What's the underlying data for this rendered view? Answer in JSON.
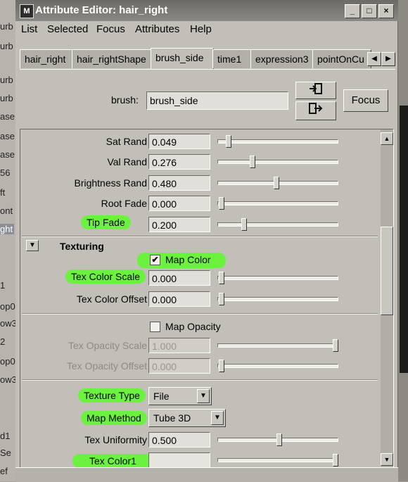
{
  "background_strip": [
    "urb",
    "urb",
    "urb",
    "urb",
    "ase",
    "ase",
    "ase",
    "56",
    "ft",
    "ont",
    "ght",
    "1",
    "op0",
    "ow3",
    "2",
    "op0",
    "ow3",
    "d1",
    "Se",
    "ef"
  ],
  "window": {
    "title": "Attribute Editor: hair_right",
    "app_icon": "M",
    "controls": {
      "minimize": "_",
      "maximize": "□",
      "close": "×"
    }
  },
  "menu": [
    "List",
    "Selected",
    "Focus",
    "Attributes",
    "Help"
  ],
  "tabs": [
    "hair_right",
    "hair_rightShape",
    "brush_side",
    "time1",
    "expression3",
    "pointOnCu"
  ],
  "active_tab": "brush_side",
  "brush": {
    "label": "brush:",
    "value": "brush_side"
  },
  "buttons": {
    "focus": "Focus",
    "load_icon": "load-node-icon",
    "select_icon": "select-node-icon"
  },
  "attrs": {
    "sat_rand": {
      "label": "Sat Rand",
      "value": "0.049",
      "slider": 0.05
    },
    "val_rand": {
      "label": "Val Rand",
      "value": "0.276",
      "slider": 0.28
    },
    "brightness_rand": {
      "label": "Brightness Rand",
      "value": "0.480",
      "slider": 0.48
    },
    "root_fade": {
      "label": "Root Fade",
      "value": "0.000",
      "slider": 0.0
    },
    "tip_fade": {
      "label": "Tip Fade",
      "value": "0.200",
      "slider": 0.2
    },
    "texturing_header": "Texturing",
    "map_color": {
      "label": "Map Color",
      "checked": "✔"
    },
    "tex_color_scale": {
      "label": "Tex Color Scale",
      "value": "0.000",
      "slider": 0.0
    },
    "tex_color_offset": {
      "label": "Tex Color Offset",
      "value": "0.000",
      "slider": 0.0
    },
    "map_opacity": {
      "label": "Map Opacity",
      "checked": ""
    },
    "tex_opacity_scale": {
      "label": "Tex Opacity Scale",
      "value": "1.000",
      "slider": 1.0
    },
    "tex_opacity_offset": {
      "label": "Tex Opacity Offset",
      "value": "0.000",
      "slider": 0.0
    },
    "texture_type": {
      "label": "Texture Type",
      "value": "File"
    },
    "map_method": {
      "label": "Map Method",
      "value": "Tube 3D"
    },
    "tex_uniformity": {
      "label": "Tex Uniformity",
      "value": "0.500",
      "slider": 0.5
    },
    "tex_color1": {
      "label": "Tex Color1",
      "slider": 1.0
    }
  },
  "colors": {
    "highlight": "#6af23e",
    "title_bar": "#7a7874",
    "panel": "#c2bfb8"
  }
}
